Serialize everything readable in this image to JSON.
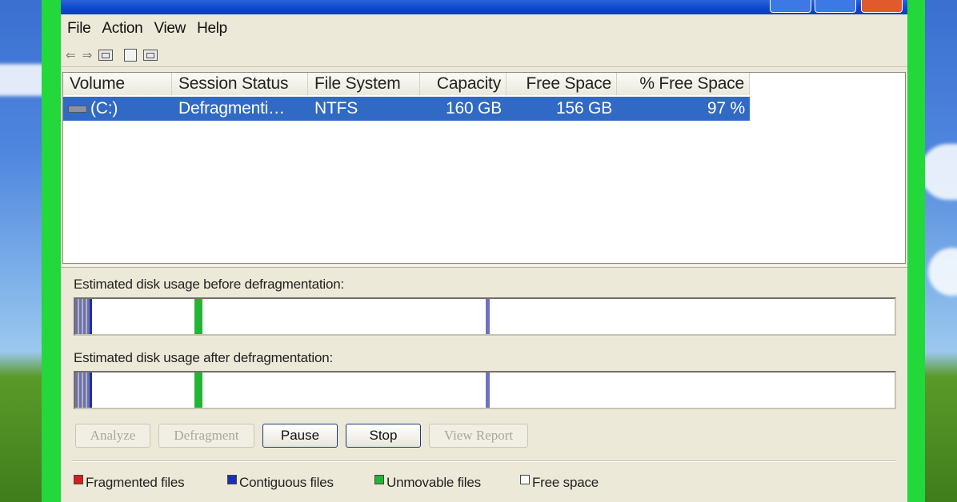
{
  "window": {
    "title": ""
  },
  "menu": [
    "File",
    "Action",
    "View",
    "Help"
  ],
  "toolbar": {
    "icons": [
      "back-arrow-icon",
      "forward-arrow-icon",
      "view-icon",
      "properties-icon",
      "view-icon"
    ],
    "glyph_back": "⇐",
    "glyph_forward": "⇒"
  },
  "volumes": {
    "columns": [
      "Volume",
      "Session Status",
      "File System",
      "Capacity",
      "Free Space",
      "% Free Space"
    ],
    "rows": [
      {
        "volume": "(C:)",
        "status": "Defragmenti…",
        "fs": "NTFS",
        "capacity": "160 GB",
        "free": "156 GB",
        "pct": "97 %"
      }
    ]
  },
  "usage": {
    "before_label": "Estimated disk usage before defragmentation:",
    "after_label": "Estimated disk usage after defragmentation:"
  },
  "buttons": {
    "analyze": "Analyze",
    "defragment": "Defragment",
    "pause": "Pause",
    "stop": "Stop",
    "view_report": "View Report"
  },
  "legend": [
    {
      "label": "Fragmented files",
      "color": "#d21f1f"
    },
    {
      "label": "Contiguous files",
      "color": "#1d2fb3"
    },
    {
      "label": "Unmovable files",
      "color": "#22b534"
    },
    {
      "label": "Free space",
      "color": "#ffffff"
    }
  ],
  "colors": {
    "selection": "#316ac5",
    "highlight_frame": "#22d83a",
    "contiguous": "#7070c0",
    "unmovable": "#22b534"
  }
}
